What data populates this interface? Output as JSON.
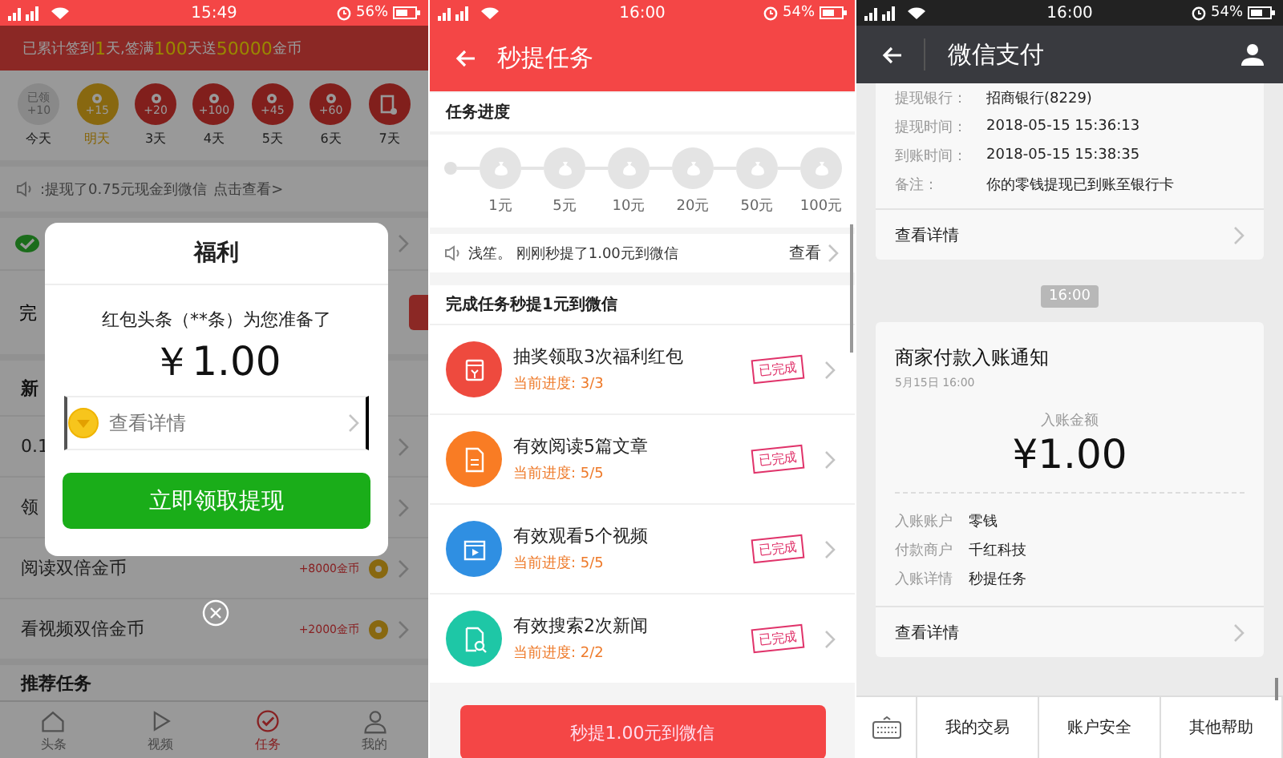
{
  "home_screen": {
    "status_bar": {
      "time": "15:49",
      "battery": "56%"
    },
    "banner": "已累计签到**1**天,签满**100**天送**50000**金币",
    "checkin_days": [
      {
        "kind": "claimed",
        "caption": "已领",
        "value": "+10",
        "label": "今天"
      },
      {
        "kind": "next",
        "value": "+15",
        "label": "明天"
      },
      {
        "kind": "coin",
        "value": "+20",
        "label": "3天"
      },
      {
        "kind": "coin",
        "value": "+100",
        "label": "4天"
      },
      {
        "kind": "coin",
        "value": "+45",
        "label": "5天"
      },
      {
        "kind": "coin",
        "value": "+60",
        "label": "6天"
      },
      {
        "kind": "gift",
        "label": "7天"
      }
    ],
    "notice": {
      "text": ":提现了0.75元现金到微信",
      "link": "点击查看>"
    },
    "withdraw_label": "完",
    "section_title": "新",
    "rows": [
      {
        "label": "0.1"
      },
      {
        "label": "领"
      },
      {
        "label": "阅读双倍金币",
        "reward": "+8000金币"
      },
      {
        "label": "看视频双倍金币",
        "reward": "+2000金币"
      }
    ],
    "section_title_2": "推荐任务",
    "tabs": [
      {
        "kind": "home",
        "label": "头条",
        "selected": false
      },
      {
        "kind": "video",
        "label": "视频",
        "selected": false
      },
      {
        "kind": "task",
        "label": "任务",
        "selected": true
      },
      {
        "kind": "profile",
        "label": "我的",
        "selected": false
      }
    ],
    "dialog": {
      "title": "福利",
      "message": "红包头条（**条）为您准备了",
      "amount": "￥1.00",
      "detail_link": "查看详情",
      "button": "立即领取提现"
    }
  },
  "task_screen": {
    "status_bar": {
      "time": "16:00",
      "battery": "54%"
    },
    "title": "秒提任务",
    "progress_title": "任务进度",
    "milestones": [
      "1元",
      "5元",
      "10元",
      "20元",
      "50元",
      "100元"
    ],
    "notice": {
      "text": "浅笙。 刚刚秒提了1.00元到微信",
      "link": "查看"
    },
    "tasks_title": "完成任务秒提1元到微信",
    "tasks": [
      {
        "kind": "envelope",
        "color": "#ee4a3e",
        "title": "抽奖领取3次福利红包",
        "progress": "当前进度: 3/3",
        "completed": true,
        "status": "已完成"
      },
      {
        "kind": "document",
        "color": "#f97c24",
        "title": "有效阅读5篇文章",
        "progress": "当前进度: 5/5",
        "completed": true,
        "status": "已完成"
      },
      {
        "kind": "video",
        "color": "#2f8fe2",
        "title": "有效观看5个视频",
        "progress": "当前进度: 5/5",
        "completed": true,
        "status": "已完成"
      },
      {
        "kind": "search",
        "color": "#1ec7a6",
        "title": "有效搜索2次新闻",
        "progress": "当前进度: 2/2",
        "completed": true,
        "status": "已完成"
      }
    ],
    "button": "秒提1.00元到微信"
  },
  "wallet_screen": {
    "status_bar": {
      "time": "16:00",
      "battery": "54%"
    },
    "title": "微信支付",
    "withdraw_details": [
      {
        "label": "提现银行：",
        "value": "招商银行(8229)"
      },
      {
        "label": "提现时间：",
        "value": "2018-05-15 15:36:13"
      },
      {
        "label": "到账时间：",
        "value": "2018-05-15 15:38:35"
      },
      {
        "label": "备注：",
        "value": "你的零钱提现已到账至银行卡"
      }
    ],
    "detail_link": "查看详情",
    "timestamp": "16:00",
    "notice": {
      "title": "商家付款入账通知",
      "date": "5月15日 16:00",
      "amount_label": "入账金额",
      "amount": "¥1.00",
      "rows": [
        {
          "label": "入账账户",
          "value": "零钱"
        },
        {
          "label": "付款商户",
          "value": "千红科技"
        },
        {
          "label": "入账详情",
          "value": "秒提任务"
        }
      ],
      "detail_link": "查看详情"
    },
    "menu": [
      "我的交易",
      "账户安全",
      "其他帮助"
    ]
  }
}
